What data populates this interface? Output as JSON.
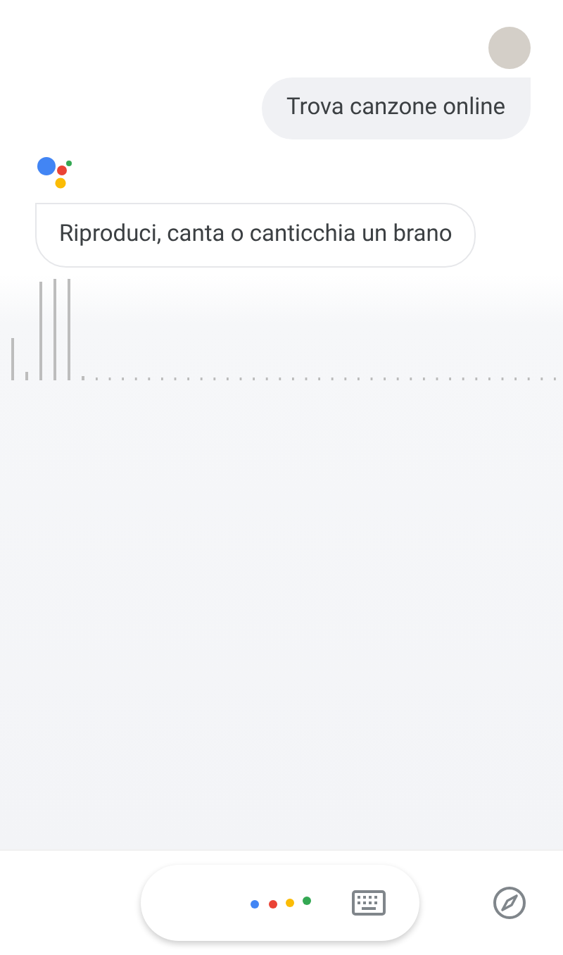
{
  "messages": [
    {
      "kind": "user",
      "text": "Trova canzone online"
    },
    {
      "kind": "assistant",
      "text": "Riproduci, canta o canticchia un brano"
    }
  ]
}
